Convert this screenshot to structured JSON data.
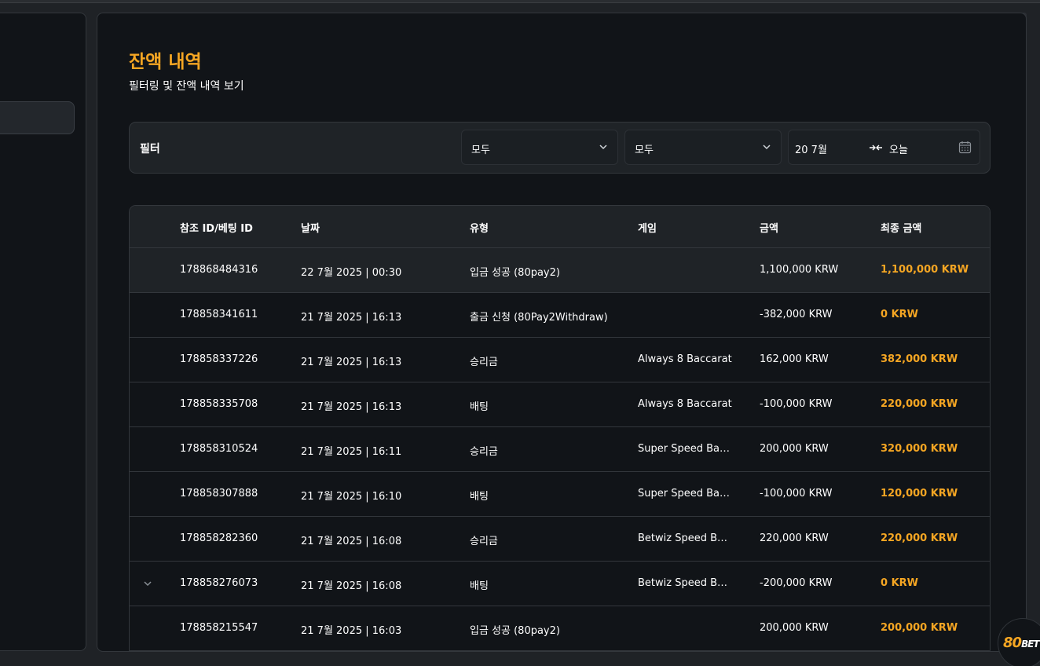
{
  "page": {
    "title": "잔액 내역",
    "subtitle": "필터링 및 잔액 내역 보기"
  },
  "filter": {
    "label": "필터",
    "select1_value": "모두",
    "select2_value": "모두",
    "date_start": "20 7월",
    "date_end": "오늘"
  },
  "table": {
    "columns": [
      "참조 ID/베팅 ID",
      "날짜",
      "유형",
      "게임",
      "금액",
      "최종 금액"
    ],
    "rows": [
      {
        "id": "178868484316",
        "date": "22 7월 2025 | 00:30",
        "type": "입금 성공 (80pay2)",
        "game": "",
        "amount": "1,100,000 KRW",
        "final": "1,100,000 KRW"
      },
      {
        "id": "178858341611",
        "date": "21 7월 2025 | 16:13",
        "type": "출금 신청 (80Pay2Withdraw)",
        "game": "",
        "amount": "-382,000 KRW",
        "final": "0 KRW"
      },
      {
        "id": "178858337226",
        "date": "21 7월 2025 | 16:13",
        "type": "승리금",
        "game": "Always 8 Baccarat",
        "amount": "162,000 KRW",
        "final": "382,000 KRW"
      },
      {
        "id": "178858335708",
        "date": "21 7월 2025 | 16:13",
        "type": "배팅",
        "game": "Always 8 Baccarat",
        "amount": "-100,000 KRW",
        "final": "220,000 KRW"
      },
      {
        "id": "178858310524",
        "date": "21 7월 2025 | 16:11",
        "type": "승리금",
        "game": "Super Speed Ba…",
        "amount": "200,000 KRW",
        "final": "320,000 KRW"
      },
      {
        "id": "178858307888",
        "date": "21 7월 2025 | 16:10",
        "type": "배팅",
        "game": "Super Speed Ba…",
        "amount": "-100,000 KRW",
        "final": "120,000 KRW"
      },
      {
        "id": "178858282360",
        "date": "21 7월 2025 | 16:08",
        "type": "승리금",
        "game": "Betwiz Speed B…",
        "amount": "220,000 KRW",
        "final": "220,000 KRW"
      },
      {
        "id": "178858276073",
        "date": "21 7월 2025 | 16:08",
        "type": "배팅",
        "game": "Betwiz Speed B…",
        "amount": "-200,000 KRW",
        "final": "0 KRW"
      },
      {
        "id": "178858215547",
        "date": "21 7월 2025 | 16:03",
        "type": "입금 성공 (80pay2)",
        "game": "",
        "amount": "200,000 KRW",
        "final": "200,000 KRW"
      }
    ]
  },
  "logo": {
    "main": "80",
    "suffix": "BET"
  },
  "colors": {
    "accent": "#f5a623",
    "panel": "#111418",
    "header": "#1f2327"
  }
}
